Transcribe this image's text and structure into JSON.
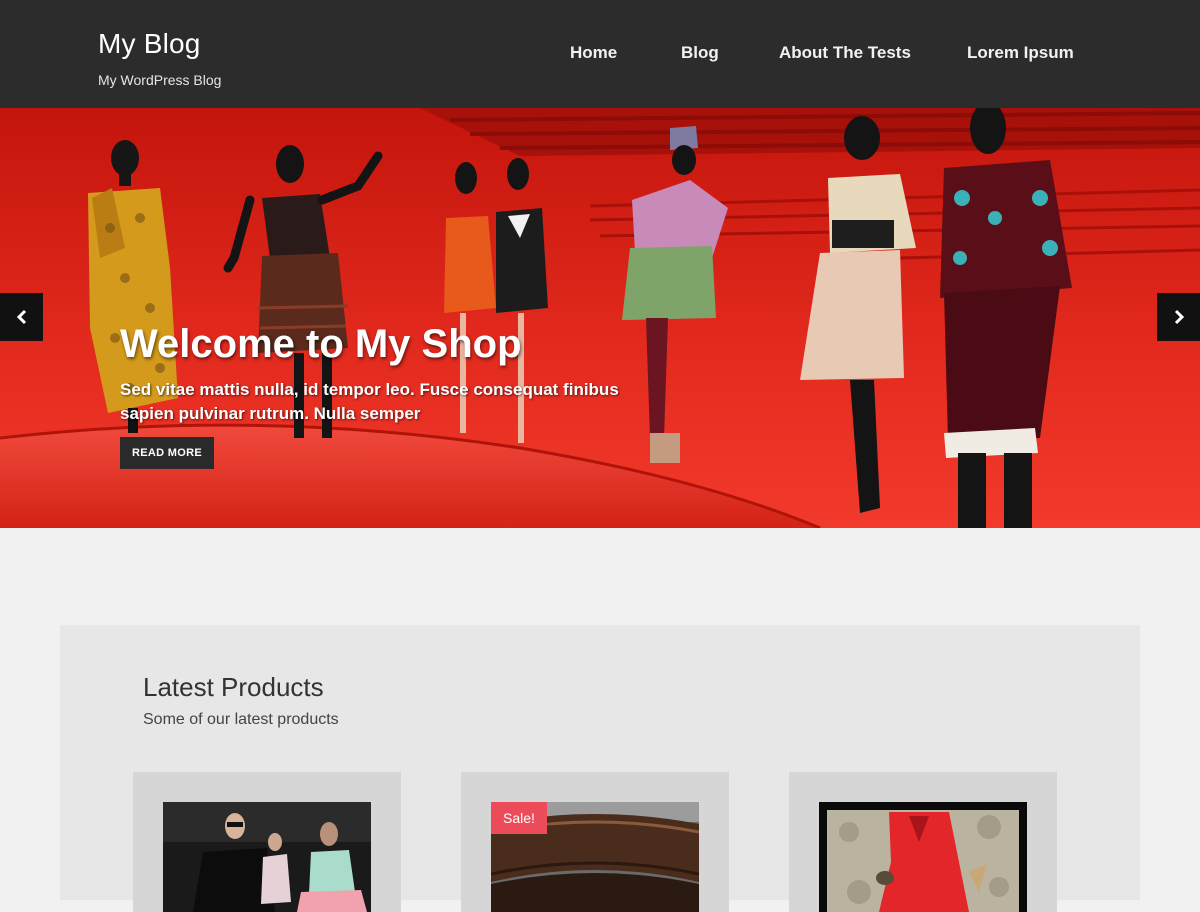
{
  "header": {
    "site_title": "My Blog",
    "tagline": "My WordPress Blog",
    "background": "#2c2c2c"
  },
  "nav": {
    "items": [
      {
        "label": "Home"
      },
      {
        "label": "Blog"
      },
      {
        "label": "About The Tests"
      },
      {
        "label": "Lorem Ipsum"
      }
    ]
  },
  "hero": {
    "title": "Welcome to My Shop",
    "text": "Sed vitae mattis nulla, id tempor leo. Fusce consequat finibus sapien pulvinar rutrum. Nulla semper",
    "button_label": "READ MORE",
    "prev_icon": "chevron-left-icon",
    "next_icon": "chevron-right-icon",
    "accent": "#d61c12"
  },
  "products": {
    "title": "Latest Products",
    "subtitle": "Some of our latest products",
    "items": [
      {
        "badge": ""
      },
      {
        "badge": "Sale!"
      },
      {
        "badge": ""
      }
    ],
    "sale_color": "#ec4c5a"
  }
}
